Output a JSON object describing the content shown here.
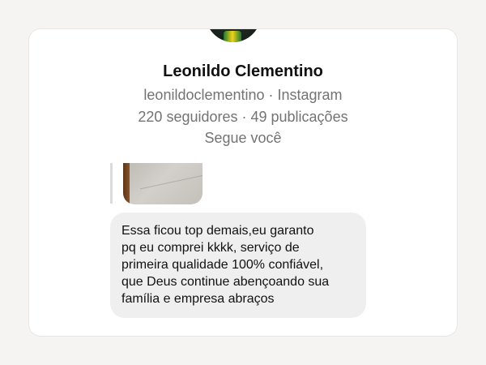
{
  "profile": {
    "name": "Leonildo Clementino",
    "handle_line": "leonildoclementino · Instagram",
    "stats_line": "220 seguidores · 49 publicações",
    "follow_status": "Segue você"
  },
  "message": {
    "text": "Essa ficou top demais,eu garanto\npq eu comprei kkkk, serviço de\nprimeira qualidade 100% confiável,\nque Deus continue abençoando sua\nfamília e empresa abraços"
  },
  "colors": {
    "card_bg": "#ffffff",
    "bubble_bg": "#efefef",
    "secondary_text": "#737373"
  }
}
